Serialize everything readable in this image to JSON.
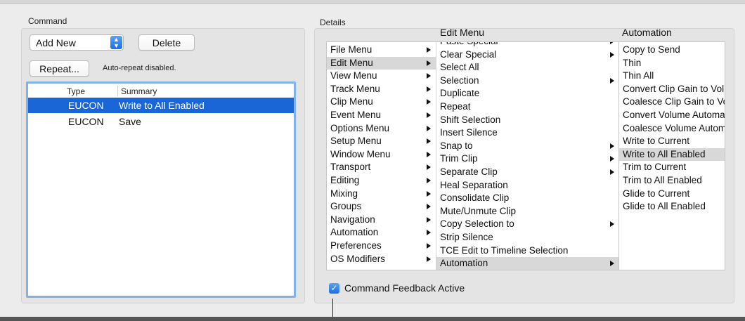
{
  "command_group": {
    "label": "Command",
    "popup_value": "Add New",
    "delete_label": "Delete",
    "repeat_label": "Repeat...",
    "auto_repeat_status": "Auto-repeat disabled.",
    "table": {
      "columns": [
        "Type",
        "Summary"
      ],
      "rows": [
        {
          "type": "EUCON",
          "summary": "Write to All Enabled",
          "selected": true
        },
        {
          "type": "EUCON",
          "summary": "Save",
          "selected": false
        }
      ]
    }
  },
  "details_group": {
    "label": "Details",
    "menu_column": {
      "items": [
        {
          "label": "File Menu",
          "submenu": true
        },
        {
          "label": "Edit Menu",
          "submenu": true,
          "selected": true
        },
        {
          "label": "View Menu",
          "submenu": true
        },
        {
          "label": "Track Menu",
          "submenu": true
        },
        {
          "label": "Clip Menu",
          "submenu": true
        },
        {
          "label": "Event Menu",
          "submenu": true
        },
        {
          "label": "Options Menu",
          "submenu": true
        },
        {
          "label": "Setup Menu",
          "submenu": true
        },
        {
          "label": "Window Menu",
          "submenu": true
        },
        {
          "label": "Transport",
          "submenu": true
        },
        {
          "label": "Editing",
          "submenu": true
        },
        {
          "label": "Mixing",
          "submenu": true
        },
        {
          "label": "Groups",
          "submenu": true
        },
        {
          "label": "Navigation",
          "submenu": true
        },
        {
          "label": "Automation",
          "submenu": true
        },
        {
          "label": "Preferences",
          "submenu": true
        },
        {
          "label": "OS Modifiers",
          "submenu": true
        }
      ]
    },
    "edit_column": {
      "header": "Edit Menu",
      "items": [
        {
          "label": "Paste Special",
          "submenu": true
        },
        {
          "label": "Clear Special",
          "submenu": true
        },
        {
          "label": "Select All",
          "submenu": false
        },
        {
          "label": "Selection",
          "submenu": true
        },
        {
          "label": "Duplicate",
          "submenu": false
        },
        {
          "label": "Repeat",
          "submenu": false
        },
        {
          "label": "Shift Selection",
          "submenu": false
        },
        {
          "label": "Insert Silence",
          "submenu": false
        },
        {
          "label": "Snap to",
          "submenu": true
        },
        {
          "label": "Trim Clip",
          "submenu": true
        },
        {
          "label": "Separate Clip",
          "submenu": true
        },
        {
          "label": "Heal Separation",
          "submenu": false
        },
        {
          "label": "Consolidate Clip",
          "submenu": false
        },
        {
          "label": "Mute/Unmute Clip",
          "submenu": false
        },
        {
          "label": "Copy Selection to",
          "submenu": true
        },
        {
          "label": "Strip Silence",
          "submenu": false
        },
        {
          "label": "TCE Edit to Timeline Selection",
          "submenu": false
        },
        {
          "label": "Automation",
          "submenu": true,
          "selected": true
        }
      ]
    },
    "automation_column": {
      "header": "Automation",
      "items": [
        {
          "label": "Copy to Send"
        },
        {
          "label": "Thin"
        },
        {
          "label": "Thin All"
        },
        {
          "label": "Convert Clip Gain to Volume"
        },
        {
          "label": "Coalesce Clip Gain to Volume"
        },
        {
          "label": "Convert Volume Automation"
        },
        {
          "label": "Coalesce Volume Automation"
        },
        {
          "label": "Write to Current"
        },
        {
          "label": "Write to All Enabled",
          "selected": true
        },
        {
          "label": "Trim to Current"
        },
        {
          "label": "Trim to All Enabled"
        },
        {
          "label": "Glide to Current"
        },
        {
          "label": "Glide to All Enabled"
        }
      ]
    },
    "feedback_checkbox": {
      "label": "Command Feedback Active",
      "checked": true
    }
  }
}
